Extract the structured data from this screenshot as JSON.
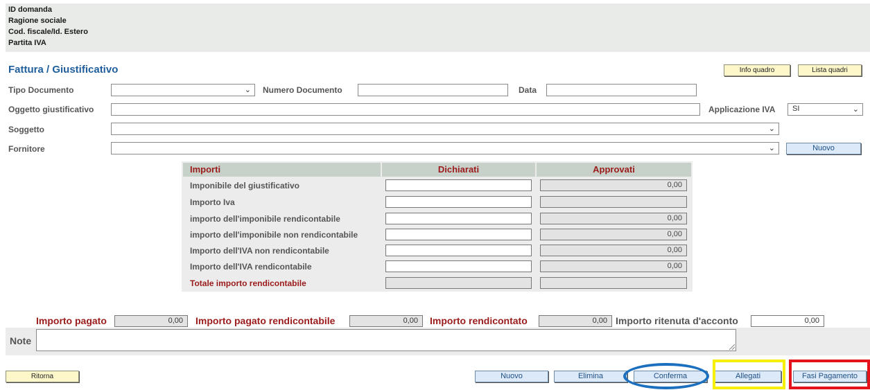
{
  "header": {
    "id_domanda": "ID domanda",
    "ragione_sociale": "Ragione sociale",
    "cod_fiscale": "Cod. fiscale/Id. Estero",
    "partita_iva": "Partita IVA"
  },
  "section_title": "Fattura / Giustificativo",
  "top_buttons": {
    "info_quadro": "Info quadro",
    "lista_quadri": "Lista quadri"
  },
  "form": {
    "tipo_documento": {
      "label": "Tipo Documento",
      "value": ""
    },
    "numero_documento": {
      "label": "Numero Documento",
      "value": ""
    },
    "data": {
      "label": "Data",
      "value": ""
    },
    "oggetto": {
      "label": "Oggetto giustificativo",
      "value": ""
    },
    "applicazione_iva": {
      "label": "Applicazione IVA",
      "value": "SI"
    },
    "soggetto": {
      "label": "Soggetto",
      "value": ""
    },
    "fornitore": {
      "label": "Fornitore",
      "value": ""
    },
    "nuovo_fornitore": "Nuovo"
  },
  "importi": {
    "headers": [
      "Importi",
      "Dichiarati",
      "Approvati"
    ],
    "rows": [
      {
        "label": "Imponibile del giustificativo",
        "dichiarato": "",
        "approvato": "0,00"
      },
      {
        "label": "Importo Iva",
        "dichiarato": "",
        "approvato": ""
      },
      {
        "label": "importo dell'imponibile rendicontabile",
        "dichiarato": "",
        "approvato": "0,00"
      },
      {
        "label": "importo dell'imponibile non rendicontabile",
        "dichiarato": "",
        "approvato": "0,00"
      },
      {
        "label": "Importo dell'IVA non rendicontabile",
        "dichiarato": "",
        "approvato": "0,00"
      },
      {
        "label": "Importo dell'IVA rendicontabile",
        "dichiarato": "",
        "approvato": "0,00"
      },
      {
        "label": "Totale importo rendicontabile",
        "dichiarato": "",
        "approvato": ""
      }
    ]
  },
  "totals": {
    "importo_pagato": {
      "label": "Importo pagato",
      "value": "0,00"
    },
    "importo_pagato_rend": {
      "label": "Importo pagato rendicontabile",
      "value": "0,00"
    },
    "importo_rendicontato": {
      "label": "Importo rendicontato",
      "value": "0,00"
    },
    "ritenuta": {
      "label": "Importo ritenuta d'acconto",
      "value": "0,00"
    }
  },
  "note_label": "Note",
  "bottom_buttons": {
    "ritorna": "Ritorna",
    "nuovo": "Nuovo",
    "elimina": "Elimina",
    "conferma": "Conferma",
    "allegati": "Allegati",
    "fasi_pagamento": "Fasi Pagamento"
  },
  "colors": {
    "title_blue": "#1f5e9c",
    "label_red": "#9b1b1b",
    "annotation_blue": "#1b6fbf",
    "annotation_yellow": "#f6f000",
    "annotation_red": "#e3121b"
  }
}
